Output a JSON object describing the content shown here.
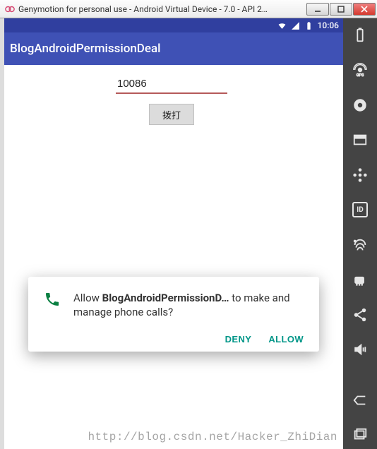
{
  "window": {
    "title": "Genymotion for personal use - Android Virtual Device - 7.0 - API 2…"
  },
  "statusbar": {
    "time": "10:06"
  },
  "app": {
    "title": "BlogAndroidPermissionDeal",
    "phone_value": "10086",
    "phone_placeholder": "",
    "dial_label": "拨打"
  },
  "dialog": {
    "prefix": "Allow ",
    "app_name": "BlogAndroidPermissionD…",
    "suffix": " to make and manage phone calls?",
    "deny": "DENY",
    "allow": "ALLOW"
  },
  "sidebar": {
    "id_label": "ID"
  },
  "watermark": "http://blog.csdn.net/Hacker_ZhiDian"
}
